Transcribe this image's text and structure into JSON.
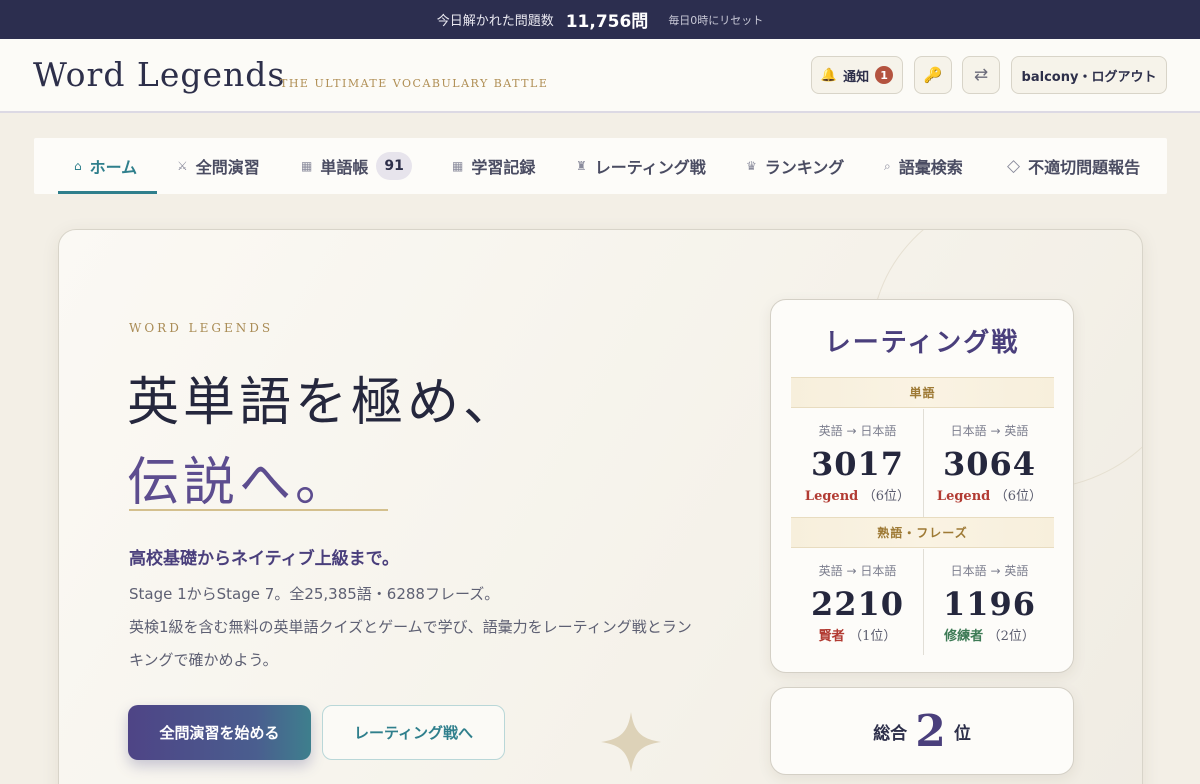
{
  "topbar": {
    "label": "今日解かれた問題数",
    "count": "11,756問",
    "reset": "毎日0時にリセット"
  },
  "header": {
    "logo": "Word Legends",
    "tagline": "THE ULTIMATE VOCABULARY BATTLE",
    "notify_label": "通知",
    "notify_count": "1",
    "user_label": "balcony・ログアウト"
  },
  "nav": {
    "items": [
      {
        "label": "ホーム",
        "icon": "home-icon"
      },
      {
        "label": "全問演習",
        "icon": "swords-icon"
      },
      {
        "label": "単語帳",
        "icon": "book-icon",
        "badge": "91"
      },
      {
        "label": "学習記録",
        "icon": "record-icon"
      },
      {
        "label": "レーティング戦",
        "icon": "rook-icon"
      },
      {
        "label": "ランキング",
        "icon": "crown-icon"
      },
      {
        "label": "語彙検索",
        "icon": "search-icon"
      },
      {
        "label": "不適切問題報告",
        "icon": "diamond-icon"
      }
    ],
    "active": "ホーム"
  },
  "hero": {
    "eyebrow": "WORD LEGENDS",
    "headline_line1": "英単語を極め、",
    "headline_line2": "伝説へ。",
    "subhead": "高校基礎からネイティブ上級まで。",
    "desc_line1": "Stage 1からStage 7。全25,385語・6288フレーズ。",
    "desc_line2": "英検1級を含む無料の英単語クイズとゲームで学び、語彙力をレーティング戦とラン",
    "desc_line3": "キングで確かめよう。",
    "primary_button": "全問演習を始める",
    "secondary_button": "レーティング戦へ"
  },
  "rating": {
    "title": "レーティング戦",
    "words": {
      "section": "単語",
      "en_ja": {
        "direction": "英語 → 日本語",
        "value": "3017",
        "title": "Legend",
        "position": "（6位）"
      },
      "ja_en": {
        "direction": "日本語 → 英語",
        "value": "3064",
        "title": "Legend",
        "position": "（6位）"
      }
    },
    "phrases": {
      "section": "熟語・フレーズ",
      "en_ja": {
        "direction": "英語 → 日本語",
        "value": "2210",
        "title": "賢者",
        "position": "（1位）"
      },
      "ja_en": {
        "direction": "日本語 → 英語",
        "value": "1196",
        "title": "修練者",
        "position": "（2位）"
      }
    },
    "overall": {
      "prefix": "総合",
      "rank": "2",
      "suffix": "位"
    }
  },
  "colors": {
    "accent_teal": "#2f7f8c",
    "accent_purple": "#4a3f7c",
    "gold": "#a98b54",
    "topbar": "#2c2e4f"
  }
}
